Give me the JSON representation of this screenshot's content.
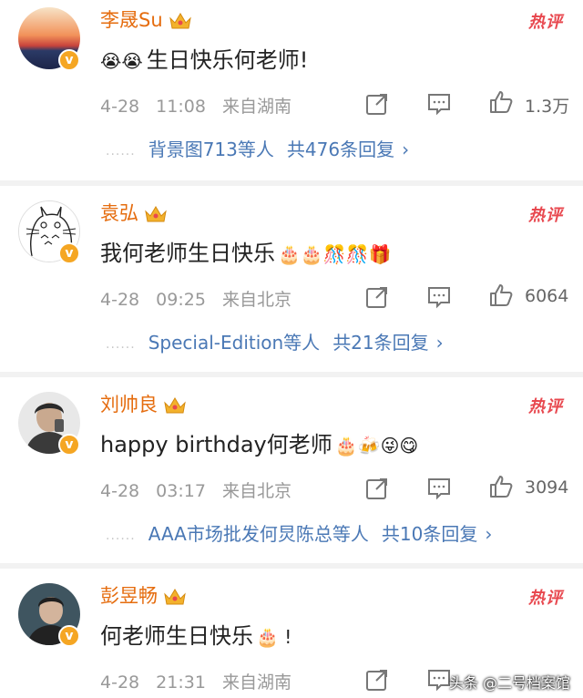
{
  "comments": [
    {
      "username": "李晟Su",
      "hot_label": "热评",
      "text": "生日快乐何老师!",
      "emoji_before": "😭😭",
      "emoji_after": "",
      "date": "4-28",
      "time": "11:08",
      "location": "来自湖南",
      "likes": "1.3万",
      "reply_names": "背景图713等人",
      "reply_total": "共476条回复",
      "chevron": "›"
    },
    {
      "username": "袁弘",
      "hot_label": "热评",
      "text": "我何老师生日快乐",
      "emoji_before": "",
      "emoji_after": "🎂🎂🎊🎊🎁",
      "date": "4-28",
      "time": "09:25",
      "location": "来自北京",
      "likes": "6064",
      "reply_names": "Special-Edition等人",
      "reply_total": "共21条回复",
      "chevron": "›"
    },
    {
      "username": "刘帅良",
      "hot_label": "热评",
      "text": "happy birthday何老师",
      "emoji_before": "",
      "emoji_after": "🎂🍻😜😋",
      "date": "4-28",
      "time": "03:17",
      "location": "来自北京",
      "likes": "3094",
      "reply_names": "AAA市场批发何炅陈总等人",
      "reply_total": "共10条回复",
      "chevron": "›"
    },
    {
      "username": "彭昱畅",
      "hot_label": "热评",
      "text": "何老师生日快乐",
      "emoji_before": "",
      "emoji_after": "🎂 !",
      "date": "4-28",
      "time": "21:31",
      "location": "来自湖南",
      "likes": "",
      "reply_names": "",
      "reply_total": "",
      "chevron": ""
    }
  ],
  "badge_glyph": "v",
  "reply_dots": "......",
  "watermark": "头条 @二号档案馆",
  "colors": {
    "username": "#e56c0e",
    "hot": "#e8484f",
    "link": "#4a78b5",
    "verified": "#f5a623"
  },
  "icons": [
    "crown-icon",
    "share-icon",
    "comment-icon",
    "like-icon",
    "verified-badge-icon"
  ]
}
